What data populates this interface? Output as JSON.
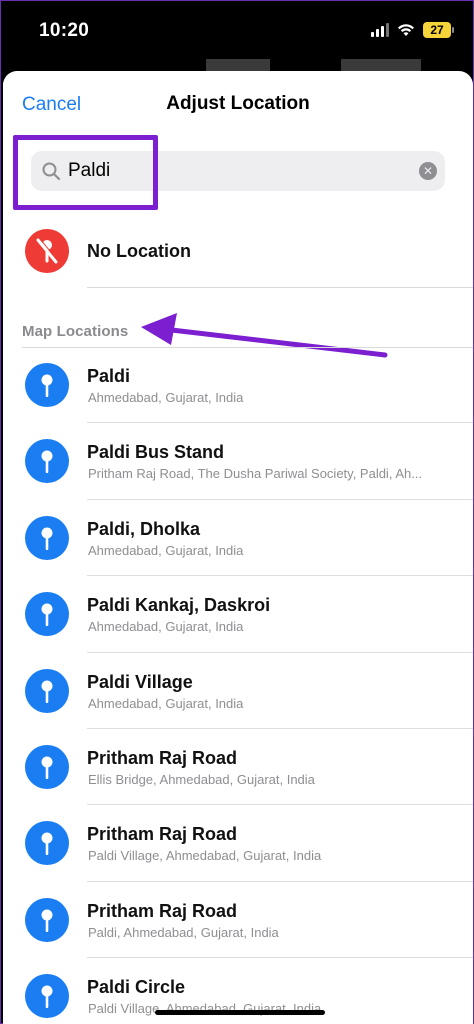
{
  "status": {
    "time": "10:20",
    "battery": "27",
    "icons": [
      "signal-icon",
      "wifi-icon",
      "battery-icon"
    ]
  },
  "nav": {
    "cancel_label": "Cancel",
    "title": "Adjust Location"
  },
  "search": {
    "value": "Paldi",
    "icons": [
      "search-icon",
      "clear-icon"
    ]
  },
  "no_location": {
    "label": "No Location",
    "icon": "no-location-pin-icon"
  },
  "section_header": "Map Locations",
  "locations": [
    {
      "title": "Paldi",
      "subtitle": "Ahmedabad, Gujarat, India"
    },
    {
      "title": "Paldi Bus Stand",
      "subtitle": "Pritham Raj Road, The Dusha Pariwal Society, Paldi, Ah..."
    },
    {
      "title": "Paldi, Dholka",
      "subtitle": "Ahmedabad, Gujarat, India"
    },
    {
      "title": "Paldi Kankaj, Daskroi",
      "subtitle": "Ahmedabad, Gujarat, India"
    },
    {
      "title": "Paldi Village",
      "subtitle": "Ahmedabad, Gujarat, India"
    },
    {
      "title": "Pritham Raj Road",
      "subtitle": "Ellis Bridge, Ahmedabad, Gujarat, India"
    },
    {
      "title": "Pritham Raj Road",
      "subtitle": "Paldi Village, Ahmedabad, Gujarat, India"
    },
    {
      "title": "Pritham Raj Road",
      "subtitle": "Paldi, Ahmedabad, Gujarat, India"
    },
    {
      "title": "Paldi Circle",
      "subtitle": "Paldi Village, Ahmedabad, Gujarat, India"
    }
  ],
  "colors": {
    "accent": "#1a7ef2",
    "annotation": "#7b1fd0",
    "no_location_red": "#ee3b35"
  }
}
